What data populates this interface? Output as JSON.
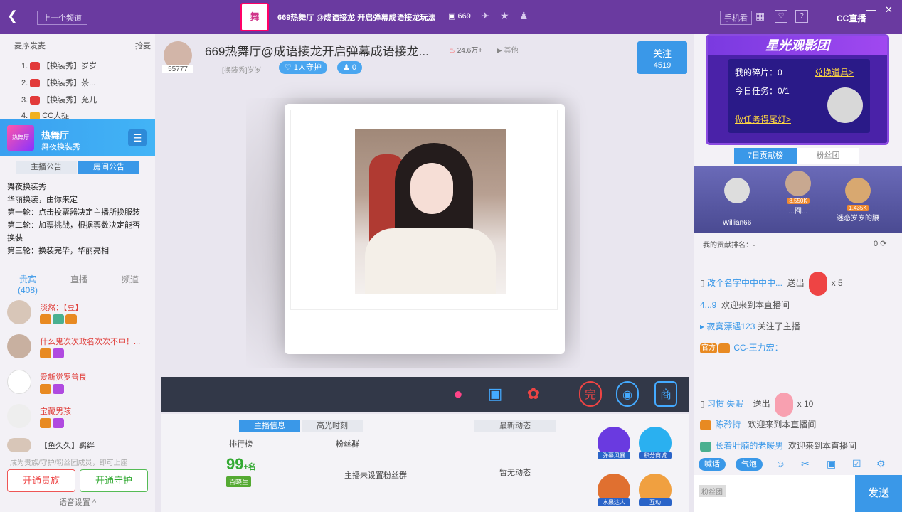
{
  "topbar": {
    "back_icon": "chevron-left-icon",
    "prev_channel": "上一个频道",
    "logo_text": "舞",
    "title": "669热舞厅 @成语接龙 开启弹幕成语接龙玩法",
    "room_id": "669",
    "phone_view": "手机看",
    "brand": "CC直播"
  },
  "left": {
    "mic_order": "麦序发麦",
    "grab_mic": "抢麦",
    "ranks": [
      {
        "num": "1.",
        "text": "【换装秀】岁岁"
      },
      {
        "num": "2.",
        "text": "【换装秀】茶..."
      },
      {
        "num": "3.",
        "text": "【换装秀】允儿"
      },
      {
        "num": "4.",
        "text": "CC大捉"
      }
    ],
    "room": {
      "name": "热舞厅",
      "sub": "舞夜换装秀"
    },
    "notice_tabs": [
      "主播公告",
      "房间公告"
    ],
    "notice_lines": [
      "舞夜换装秀",
      "华丽换装，由你来定",
      "第一轮：点击投票器决定主播所换服装",
      "第二轮：加票挑战，根据票数决定能否换装",
      "第三轮：换装完毕，华丽亮相"
    ],
    "user_tabs": {
      "guest": "贵宾",
      "guest_count": "(408)",
      "live": "直播",
      "channel": "频道"
    },
    "users": [
      {
        "name": "淡然：【豆】"
      },
      {
        "name": "什么鬼次次政名次次不中！..."
      },
      {
        "name": "爱新觉罗善良"
      },
      {
        "name": "宝藏男孩"
      },
      {
        "name": "【鱼久久】羁绊"
      }
    ],
    "hint": "成为贵族/守护/粉丝团成员，即可上座",
    "open_noble": "开通贵族",
    "open_guard": "开通守护",
    "voice_settings": "语音设置 ^"
  },
  "anchor": {
    "id": "55777",
    "title": "669热舞厅@成语接龙开启弹幕成语接龙...",
    "hot": "24.6万+",
    "other": "其他",
    "tag": "[换装秀]岁岁",
    "guard": "1人守护",
    "fans": "0",
    "follow": "关注",
    "follow_count": "4519"
  },
  "bottom": {
    "tabs": [
      "主播信息",
      "高光时刻"
    ],
    "rank_label": "排行榜",
    "fans_label": "粉丝群",
    "score": "99",
    "score_suffix": "+名",
    "score_badge": "百晓生",
    "fans_status": "主播未设置粉丝群",
    "news_tab": "最新动态",
    "no_news": "暂无动态",
    "acts": [
      "弹幕风暴",
      "积分商城",
      "水果达人",
      "互动"
    ]
  },
  "right": {
    "banner_title": "星光观影团",
    "my_shard": "我的碎片：0",
    "redeem": "兑换道具>",
    "today_task": "今日任务：0/1",
    "task_link": "做任务得尾灯>",
    "tabs": [
      "7日贡献榜",
      "粉丝团"
    ],
    "podium": [
      {
        "name": "Willian66",
        "value": ""
      },
      {
        "name": "...阁...",
        "value": "8,550K"
      },
      {
        "name": "迷恋岁岁的腰",
        "value": "1,435K"
      }
    ],
    "my_rank": "我的贡献排名：-",
    "my_rank_val": "0",
    "chat": [
      {
        "who": "改个名字中中中中...",
        "act": "送出",
        "count": "x 5"
      },
      {
        "who": "4...9",
        "act": "欢迎来到本直播间",
        "count": ""
      },
      {
        "who": "寂寞漂遇123",
        "act": "关注了主播",
        "count": ""
      },
      {
        "who": "CC-王力宏：",
        "act": "",
        "count": "",
        "badge": "官方"
      },
      {
        "who": "习惯 失眠",
        "act": "送出",
        "count": "x 10"
      },
      {
        "who": "陈矜持",
        "act": "欢迎来到本直播间",
        "count": ""
      },
      {
        "who": "长着肚腩的老暖男",
        "act": "欢迎来到本直播间",
        "count": ""
      }
    ],
    "input_btns": [
      "喊话",
      "气泡"
    ],
    "fan_group": "粉丝团",
    "send": "发送"
  }
}
